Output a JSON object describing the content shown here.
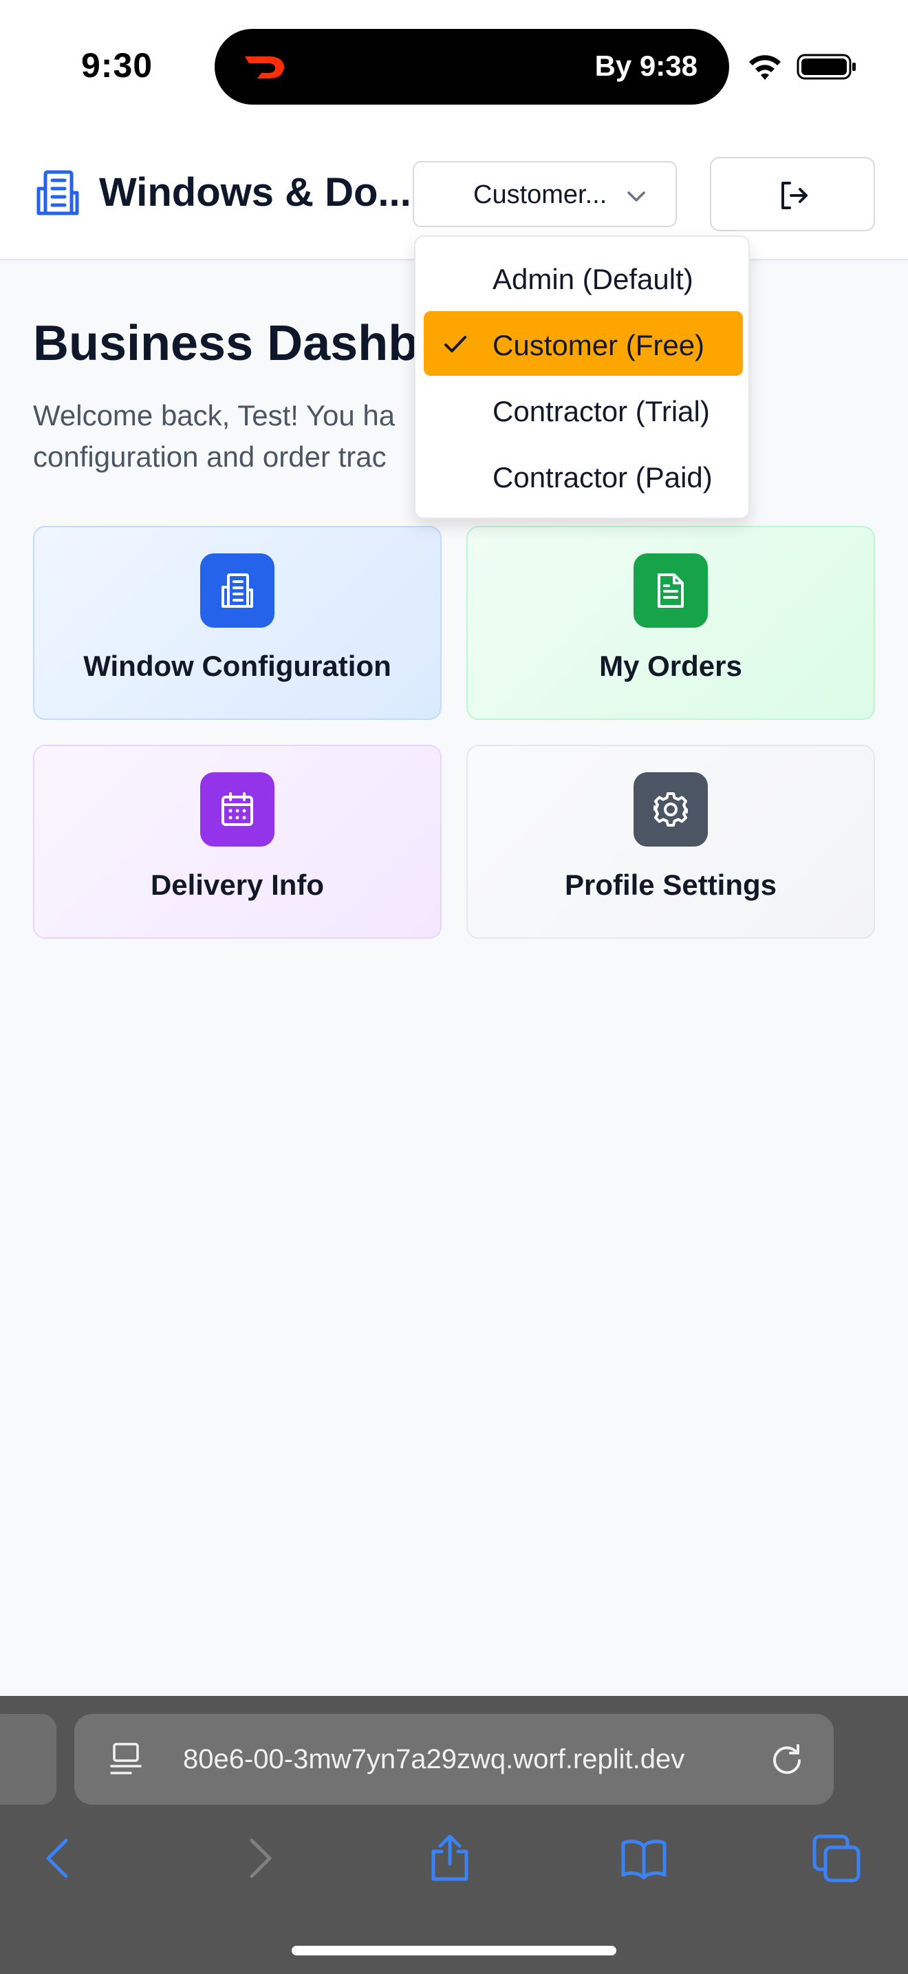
{
  "status_bar": {
    "time": "9:30",
    "activity": "By 9:38"
  },
  "header": {
    "title": "Windows & Do...",
    "role_select_value": "Customer..."
  },
  "dropdown": {
    "options": [
      {
        "label": "Admin (Default)",
        "selected": false
      },
      {
        "label": "Customer (Free)",
        "selected": true
      },
      {
        "label": "Contractor (Trial)",
        "selected": false
      },
      {
        "label": "Contractor (Paid)",
        "selected": false
      }
    ]
  },
  "main": {
    "title": "Business Dashb",
    "welcome_line1": "Welcome back, Test! You ha",
    "welcome_line2": "configuration and order trac",
    "cards": [
      {
        "title": "Window Configuration",
        "icon": "building-icon",
        "color": "#2563eb"
      },
      {
        "title": "My Orders",
        "icon": "document-icon",
        "color": "#16a34a"
      },
      {
        "title": "Delivery Info",
        "icon": "calendar-icon",
        "color": "#9333ea"
      },
      {
        "title": "Profile Settings",
        "icon": "gear-icon",
        "color": "#4b5563"
      }
    ]
  },
  "browser": {
    "url": "80e6-00-3mw7yn7a29zwq.worf.replit.dev"
  },
  "colors": {
    "accent": "#ffa500",
    "brand_blue": "#2563eb",
    "nav_blue": "#3b82f6"
  }
}
